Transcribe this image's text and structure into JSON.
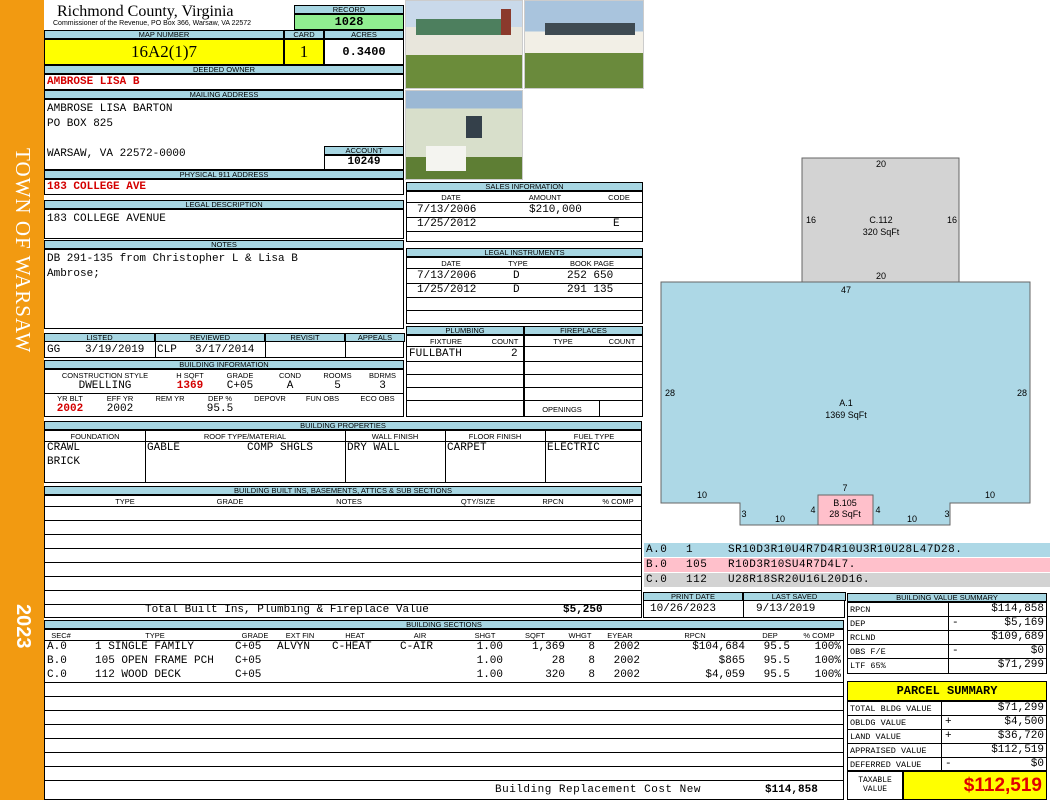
{
  "sidebar": {
    "town": "TOWN OF WARSAW",
    "year": "2023"
  },
  "header": {
    "county": "Richmond County, Virginia",
    "commissioner": "Commissioner of the Revenue, PO Box 366, Warsaw, VA 22572",
    "record_label": "RECORD",
    "record": "1028",
    "map_label": "MAP NUMBER",
    "map_number": "16A2(1)7",
    "card_label": "CARD",
    "card": "1",
    "acres_label": "ACRES",
    "acres": "0.3400"
  },
  "owner": {
    "deeded_label": "DEEDED OWNER",
    "deeded": "AMBROSE LISA B",
    "mailing_label": "MAILING ADDRESS",
    "mail1": "AMBROSE LISA BARTON",
    "mail2": "PO BOX 825",
    "mail3": "WARSAW, VA 22572-0000",
    "account_label": "ACCOUNT",
    "account": "10249",
    "physical_label": "PHYSICAL 911 ADDRESS",
    "physical": "183 COLLEGE AVE",
    "legal_label": "LEGAL DESCRIPTION",
    "legal": "183 COLLEGE AVENUE",
    "notes_label": "NOTES",
    "notes1": "DB 291-135 from Christopher L & Lisa B",
    "notes2": "Ambrose;"
  },
  "sales": {
    "title": "SALES INFORMATION",
    "headers": [
      "DATE",
      "AMOUNT",
      "CODE"
    ],
    "rows": [
      [
        "7/13/2006",
        "$210,000",
        ""
      ],
      [
        "1/25/2012",
        "",
        "E"
      ]
    ]
  },
  "legal_instr": {
    "title": "LEGAL INSTRUMENTS",
    "headers": [
      "DATE",
      "TYPE",
      "BOOK PAGE"
    ],
    "rows": [
      [
        "7/13/2006",
        "D",
        "252 650"
      ],
      [
        "1/25/2012",
        "D",
        "291 135"
      ]
    ]
  },
  "listed": {
    "headers": [
      "LISTED",
      "REVIEWED",
      "REVISIT",
      "APPEALS"
    ],
    "listed_by": "GG",
    "listed_date": "3/19/2019",
    "reviewed_by": "CLP",
    "reviewed_date": "3/17/2014"
  },
  "building_info": {
    "title": "BUILDING INFORMATION",
    "h1": [
      "CONSTRUCTION STYLE",
      "H SQFT",
      "GRADE",
      "COND",
      "ROOMS",
      "BDRMS"
    ],
    "v1": [
      "DWELLING",
      "1369",
      "C+05",
      "A",
      "5",
      "3"
    ],
    "h2": [
      "YR BLT",
      "EFF YR",
      "REM YR",
      "DEP %",
      "DEPOVR",
      "FUN OBS",
      "ECO OBS"
    ],
    "v2": [
      "2002",
      "2002",
      "",
      "95.5",
      "",
      "",
      ""
    ]
  },
  "plumbing": {
    "title": "PLUMBING",
    "headers": [
      "FIXTURE",
      "COUNT"
    ],
    "fixture": "FULLBATH",
    "count": "2"
  },
  "fireplaces": {
    "title": "FIREPLACES",
    "headers": [
      "TYPE",
      "COUNT"
    ],
    "openings": "OPENINGS"
  },
  "props": {
    "title": "BUILDING PROPERTIES",
    "headers": [
      "FOUNDATION",
      "ROOF TYPE/MATERIAL",
      "WALL FINISH",
      "FLOOR FINISH",
      "FUEL TYPE"
    ],
    "foundation1": "CRAWL",
    "foundation2": "BRICK",
    "roof_type": "GABLE",
    "roof_mat": "COMP SHGLS",
    "wall": "DRY WALL",
    "floor": "CARPET",
    "fuel": "ELECTRIC"
  },
  "builtins": {
    "title": "BUILDING BUILT INS, BASEMENTS, ATTICS & SUB SECTIONS",
    "headers": [
      "TYPE",
      "GRADE",
      "NOTES",
      "QTY/SIZE",
      "RPCN",
      "% COMP"
    ],
    "total_label": "Total Built Ins, Plumbing & Fireplace Value",
    "total": "$5,250"
  },
  "print": {
    "headers": [
      "PRINT DATE",
      "LAST SAVED"
    ],
    "print_date": "10/26/2023",
    "last_saved": "9/13/2019"
  },
  "sections": {
    "title": "BUILDING SECTIONS",
    "headers": [
      "SEC#",
      "TYPE",
      "GRADE",
      "EXT FIN",
      "HEAT",
      "AIR",
      "SHGT",
      "SQFT",
      "WHGT",
      "EYEAR",
      "RPCN",
      "DEP",
      "% COMP"
    ],
    "rows": [
      [
        "A.0",
        "1 SINGLE FAMILY",
        "C+05",
        "ALVYN",
        "C-HEAT",
        "C-AIR",
        "1.00",
        "1,369",
        "8",
        "2002",
        "$104,684",
        "95.5",
        "100%"
      ],
      [
        "B.0",
        "105 OPEN FRAME PCH",
        "C+05",
        "",
        "",
        "",
        "1.00",
        "28",
        "8",
        "2002",
        "$865",
        "95.5",
        "100%"
      ],
      [
        "C.0",
        "112 WOOD DECK",
        "C+05",
        "",
        "",
        "",
        "1.00",
        "320",
        "8",
        "2002",
        "$4,059",
        "95.5",
        "100%"
      ]
    ],
    "brcn_label": "Building Replacement Cost New",
    "brcn": "$114,858"
  },
  "sketch": {
    "c_label": "C.112",
    "c_area": "320 SqFt",
    "a_label": "A.1",
    "a_area": "1369 SqFt",
    "b_label": "B.105",
    "b_area": "28 SqFt",
    "dims": {
      "c_top": "20",
      "c_left": "16",
      "c_right": "16",
      "c_bottom": "20",
      "a_top": "47",
      "a_left": "28",
      "a_right": "28",
      "a_step_l": "10",
      "a_step_r": "10",
      "a_notch_l": "3",
      "a_notch_r": "3",
      "a_bot_l": "10",
      "a_bot_r": "10",
      "b_top": "7",
      "b_l": "4",
      "b_r": "4"
    },
    "colors": {
      "c": "#d3d3d3",
      "a": "#add8e6",
      "b": "#ffc0cb"
    },
    "legend": [
      {
        "sec": "A.0",
        "code": "1",
        "desc": "SR10D3R10U4R7D4R10U3R10U28L47D28.",
        "color": "#add8e6"
      },
      {
        "sec": "B.0",
        "code": "105",
        "desc": "R10D3R10SU4R7D4L7.",
        "color": "#ffc0cb"
      },
      {
        "sec": "C.0",
        "code": "112",
        "desc": "U28R18SR20U16L20D16.",
        "color": "#d3d3d3"
      }
    ]
  },
  "bvs": {
    "title": "BUILDING VALUE SUMMARY",
    "rows": [
      [
        "RPCN",
        "",
        "$114,858"
      ],
      [
        "DEP",
        "-",
        "$5,169"
      ],
      [
        "RCLND",
        "",
        "$109,689"
      ],
      [
        "OBS F/E",
        "-",
        "$0"
      ],
      [
        "LTF   65%",
        "",
        "$71,299"
      ]
    ]
  },
  "parcel": {
    "title": "PARCEL SUMMARY",
    "rows": [
      [
        "TOTAL BLDG VALUE",
        "",
        "$71,299"
      ],
      [
        "OBLDG VALUE",
        "+",
        "$4,500"
      ],
      [
        "LAND VALUE",
        "+",
        "$36,720"
      ],
      [
        "APPRAISED VALUE",
        "",
        "$112,519"
      ],
      [
        "DEFERRED VALUE",
        "-",
        "$0"
      ]
    ],
    "taxable_label1": "TAXABLE",
    "taxable_label2": "VALUE",
    "taxable": "$112,519"
  }
}
